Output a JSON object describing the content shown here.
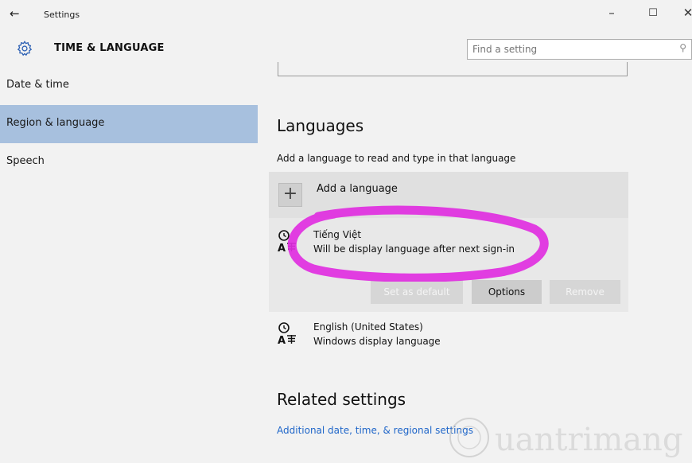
{
  "window": {
    "back_icon": "back-arrow-icon",
    "title": "Settings",
    "minimize": "–",
    "maximize": "☐",
    "close": "✕"
  },
  "header": {
    "icon": "gear-icon",
    "title": "TIME & LANGUAGE",
    "search_placeholder": "Find a setting",
    "search_icon": "search-icon"
  },
  "sidebar": {
    "items": [
      {
        "label": "Date & time",
        "selected": false
      },
      {
        "label": "Region & language",
        "selected": true
      },
      {
        "label": "Speech",
        "selected": false
      }
    ]
  },
  "languages": {
    "heading": "Languages",
    "description": "Add a language to read and type in that language",
    "add_label": "Add a language",
    "add_icon": "plus-icon",
    "installed": [
      {
        "name": "Tiếng Việt",
        "status": "Will be display language after next sign-in",
        "icon": "language-icon",
        "selected": true,
        "buttons": {
          "set_default": "Set as default",
          "options": "Options",
          "remove": "Remove"
        }
      },
      {
        "name": "English (United States)",
        "status": "Windows display language",
        "icon": "language-icon",
        "selected": false
      }
    ]
  },
  "related": {
    "heading": "Related settings",
    "link": "Additional date, time, & regional settings"
  },
  "annotation": {
    "highlight_color": "#e02ee0"
  },
  "colors": {
    "selected_nav": "#a7c0de",
    "link": "#1f66c9",
    "background": "#f2f2f2"
  }
}
